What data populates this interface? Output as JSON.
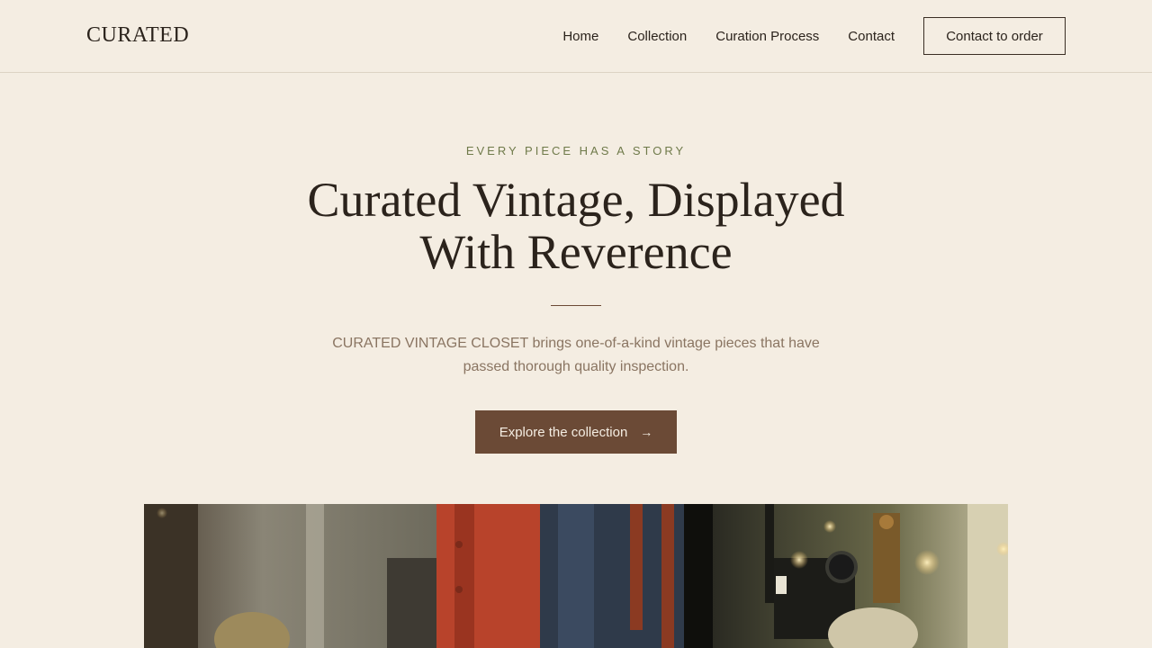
{
  "header": {
    "logo": "CURATED",
    "nav": [
      {
        "label": "Home"
      },
      {
        "label": "Collection"
      },
      {
        "label": "Curation Process"
      },
      {
        "label": "Contact"
      }
    ],
    "cta_label": "Contact to order"
  },
  "hero": {
    "eyebrow": "EVERY PIECE HAS A STORY",
    "headline_line1": "Curated Vintage, Displayed",
    "headline_line2": "With Reverence",
    "subtitle_line1": "CURATED VINTAGE CLOSET brings one-of-a-kind vintage pieces that have",
    "subtitle_line2": "passed thorough quality inspection.",
    "cta_label": "Explore the collection",
    "cta_arrow": "→"
  },
  "colors": {
    "background": "#f4ede2",
    "accent": "#6b4a36",
    "eyebrow": "#6f7a4a",
    "text": "#2b231c",
    "muted_text": "#8a7562"
  }
}
